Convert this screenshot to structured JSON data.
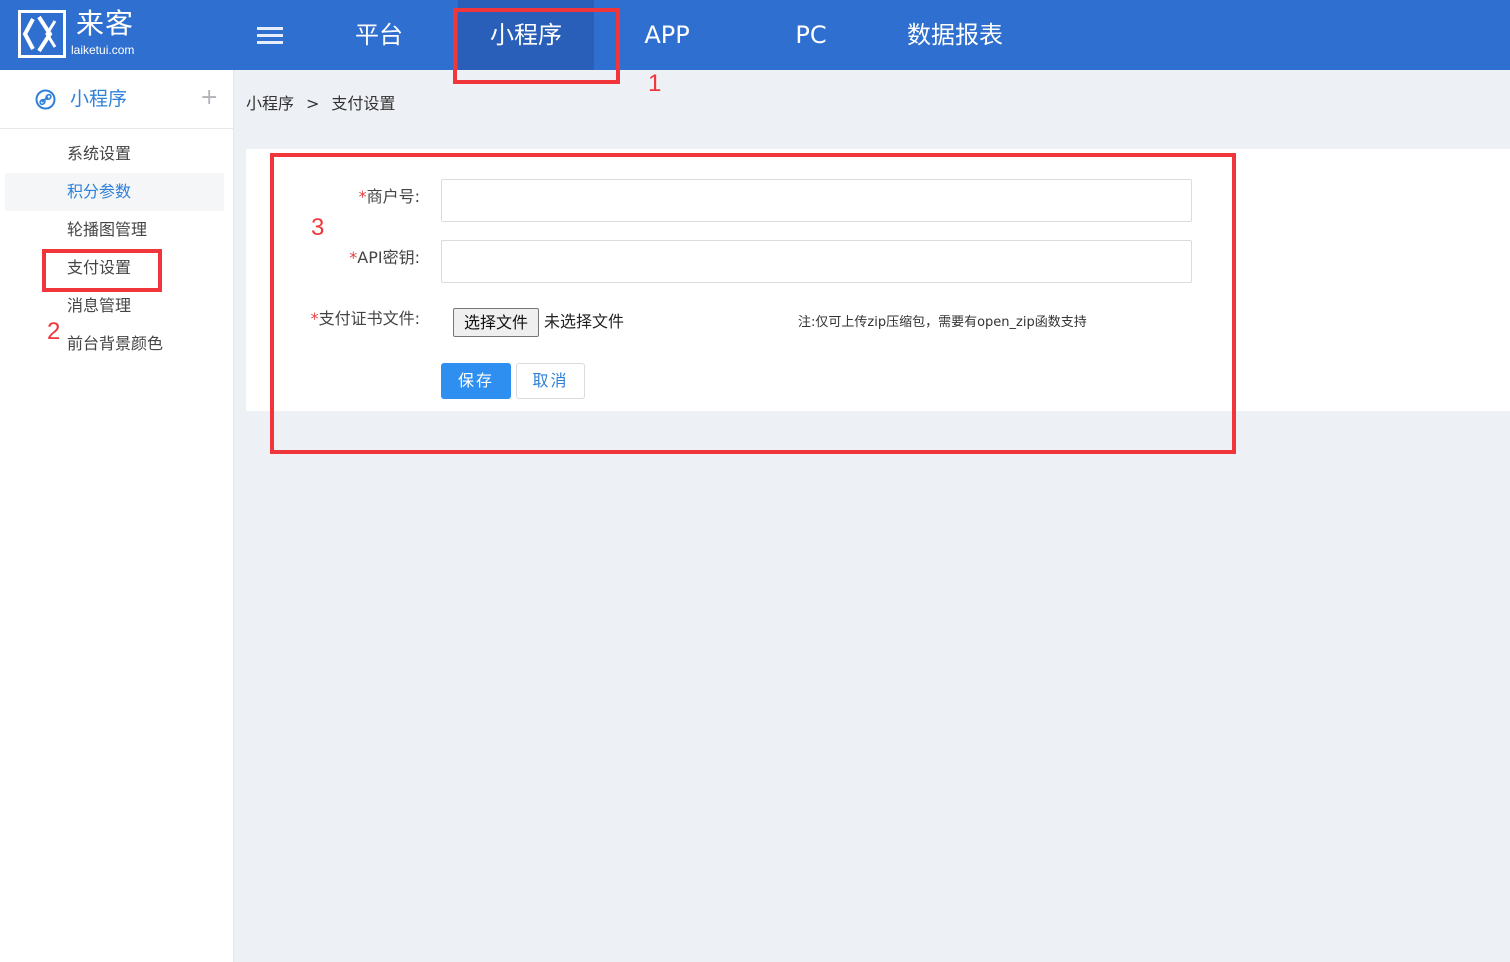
{
  "brand": {
    "name": "来客",
    "domain": "laiketui.com"
  },
  "topnav": {
    "items": [
      {
        "label": "平台"
      },
      {
        "label": "小程序"
      },
      {
        "label": "APP"
      },
      {
        "label": "PC"
      },
      {
        "label": "数据报表"
      }
    ],
    "active": "小程序"
  },
  "sidebar": {
    "section_label": "小程序",
    "expand_symbol": "+",
    "items": [
      {
        "label": "系统设置"
      },
      {
        "label": "积分参数"
      },
      {
        "label": "轮播图管理"
      },
      {
        "label": "支付设置"
      },
      {
        "label": "消息管理"
      },
      {
        "label": "前台背景颜色"
      }
    ],
    "active": "积分参数"
  },
  "breadcrumb": {
    "parent": "小程序",
    "separator": ">",
    "current": "支付设置"
  },
  "form": {
    "required_mark": "*",
    "merchant_id": {
      "label": "商户号:",
      "value": ""
    },
    "api_key": {
      "label": "API密钥:",
      "value": ""
    },
    "cert_file": {
      "label": "支付证书文件:",
      "choose_button": "选择文件",
      "status": "未选择文件",
      "note": "注:仅可上传zip压缩包，需要有open_zip函数支持"
    },
    "save_button": "保存",
    "cancel_button": "取消"
  },
  "annotations": [
    {
      "number": "1"
    },
    {
      "number": "2"
    },
    {
      "number": "3"
    }
  ],
  "colors": {
    "topbar": "#2f6fd0",
    "topbar_active": "#2a5fb9",
    "accent": "#2f80d8",
    "primary_button": "#2f8ff0",
    "annotation_red": "#f0363a",
    "required": "#e04040"
  }
}
